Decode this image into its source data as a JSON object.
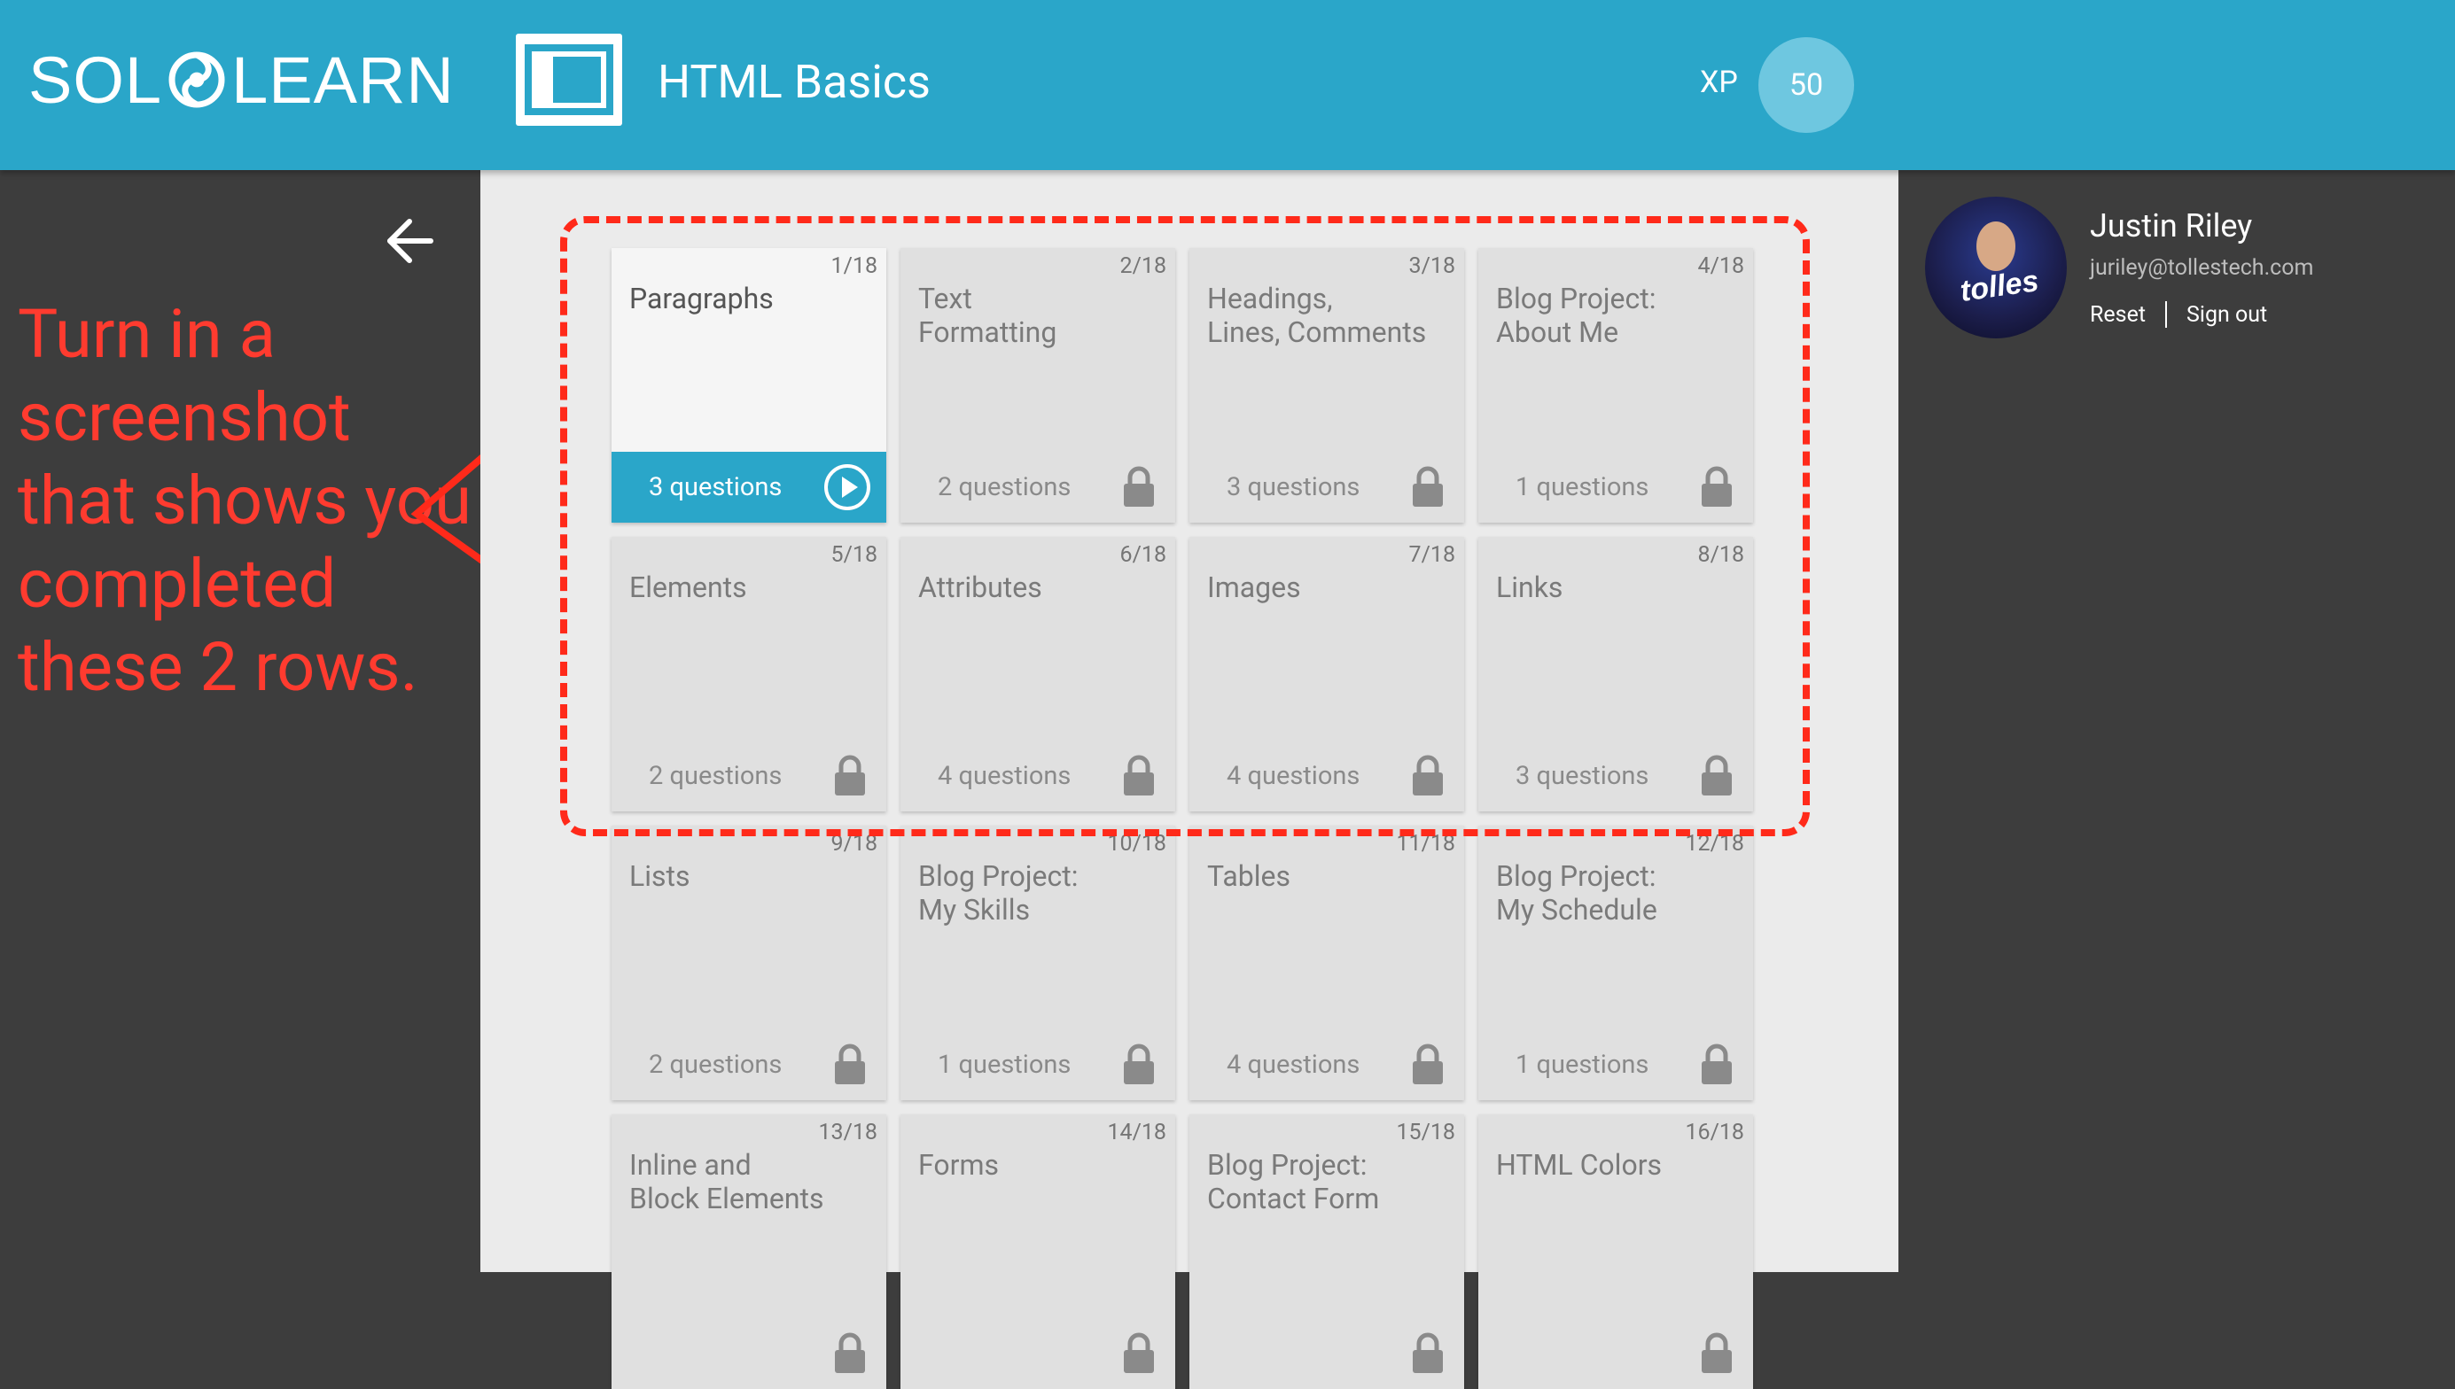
{
  "header": {
    "logo_text_left": "SOL",
    "logo_text_right": "LEARN",
    "course_title": "HTML Basics",
    "xp_label": "XP",
    "xp_value": "50"
  },
  "annotation": {
    "text": "Turn in a screenshot that shows you completed these 2 rows."
  },
  "user": {
    "name": "Justin Riley",
    "email": "juriley@tollestech.com",
    "reset_label": "Reset",
    "signout_label": "Sign out",
    "avatar_brand": "tolles"
  },
  "lessons": [
    {
      "num": "1/18",
      "title": "Paragraphs",
      "questions": "3 questions",
      "state": "active"
    },
    {
      "num": "2/18",
      "title": "Text\nFormatting",
      "questions": "2 questions",
      "state": "locked"
    },
    {
      "num": "3/18",
      "title": "Headings,\nLines, Comments",
      "questions": "3 questions",
      "state": "locked"
    },
    {
      "num": "4/18",
      "title": "Blog Project:\nAbout Me",
      "questions": "1 questions",
      "state": "locked"
    },
    {
      "num": "5/18",
      "title": "Elements",
      "questions": "2 questions",
      "state": "locked"
    },
    {
      "num": "6/18",
      "title": "Attributes",
      "questions": "4 questions",
      "state": "locked"
    },
    {
      "num": "7/18",
      "title": "Images",
      "questions": "4 questions",
      "state": "locked"
    },
    {
      "num": "8/18",
      "title": "Links",
      "questions": "3 questions",
      "state": "locked"
    },
    {
      "num": "9/18",
      "title": "Lists",
      "questions": "2 questions",
      "state": "locked"
    },
    {
      "num": "10/18",
      "title": "Blog Project:\nMy Skills",
      "questions": "1 questions",
      "state": "locked"
    },
    {
      "num": "11/18",
      "title": "Tables",
      "questions": "4 questions",
      "state": "locked"
    },
    {
      "num": "12/18",
      "title": "Blog Project:\nMy Schedule",
      "questions": "1 questions",
      "state": "locked"
    },
    {
      "num": "13/18",
      "title": "Inline and\nBlock Elements",
      "questions": "",
      "state": "locked"
    },
    {
      "num": "14/18",
      "title": "Forms",
      "questions": "",
      "state": "locked"
    },
    {
      "num": "15/18",
      "title": "Blog Project:\nContact Form",
      "questions": "",
      "state": "locked"
    },
    {
      "num": "16/18",
      "title": "HTML Colors",
      "questions": "",
      "state": "locked"
    }
  ],
  "colors": {
    "brand": "#2aa6c9",
    "annotation": "#ff3b2f",
    "sidebar": "#3d3d3d",
    "main_bg": "#ebebeb",
    "card": "#e0e0e0"
  }
}
